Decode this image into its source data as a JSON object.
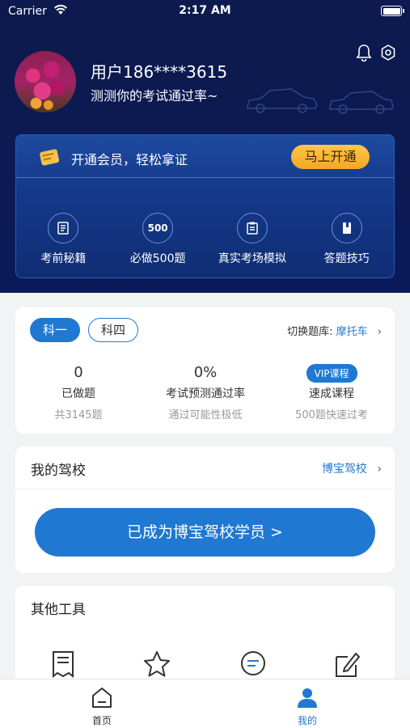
{
  "status_bar": {
    "carrier": "Carrier",
    "time": "2:17 AM"
  },
  "profile": {
    "name": "用户186****3615",
    "subtitle": "测测你的考试通过率~"
  },
  "vip": {
    "promo_text": "开通会员，轻松拿证",
    "button_label": "马上开通",
    "items": [
      {
        "label": "考前秘籍",
        "icon": "document-icon"
      },
      {
        "label": "必做500题",
        "icon": "500-icon",
        "icon_text": "500"
      },
      {
        "label": "真实考场模拟",
        "icon": "clipboard-icon"
      },
      {
        "label": "答题技巧",
        "icon": "book-icon"
      }
    ]
  },
  "subjects": {
    "tabs": [
      {
        "label": "科一",
        "active": true
      },
      {
        "label": "科四",
        "active": false
      }
    ],
    "switch_label": "切换题库:",
    "switch_value": "摩托车",
    "stats": [
      {
        "value": "0",
        "label": "已做题",
        "sub": "共3145题"
      },
      {
        "value": "0%",
        "label": "考试预测通过率",
        "sub": "通过可能性极低"
      },
      {
        "badge": "VIP课程",
        "label": "速成课程",
        "sub": "500题快速过考"
      }
    ]
  },
  "school": {
    "title": "我的驾校",
    "link": "博宝驾校",
    "button_label": "已成为博宝驾校学员 >"
  },
  "tools": {
    "title": "其他工具"
  },
  "tabbar": {
    "items": [
      {
        "label": "首页",
        "active": false
      },
      {
        "label": "我的",
        "active": true
      }
    ]
  },
  "colors": {
    "primary": "#1f78d1",
    "header_bg": "#0d1a4f",
    "vip_button": "#f4a624"
  }
}
